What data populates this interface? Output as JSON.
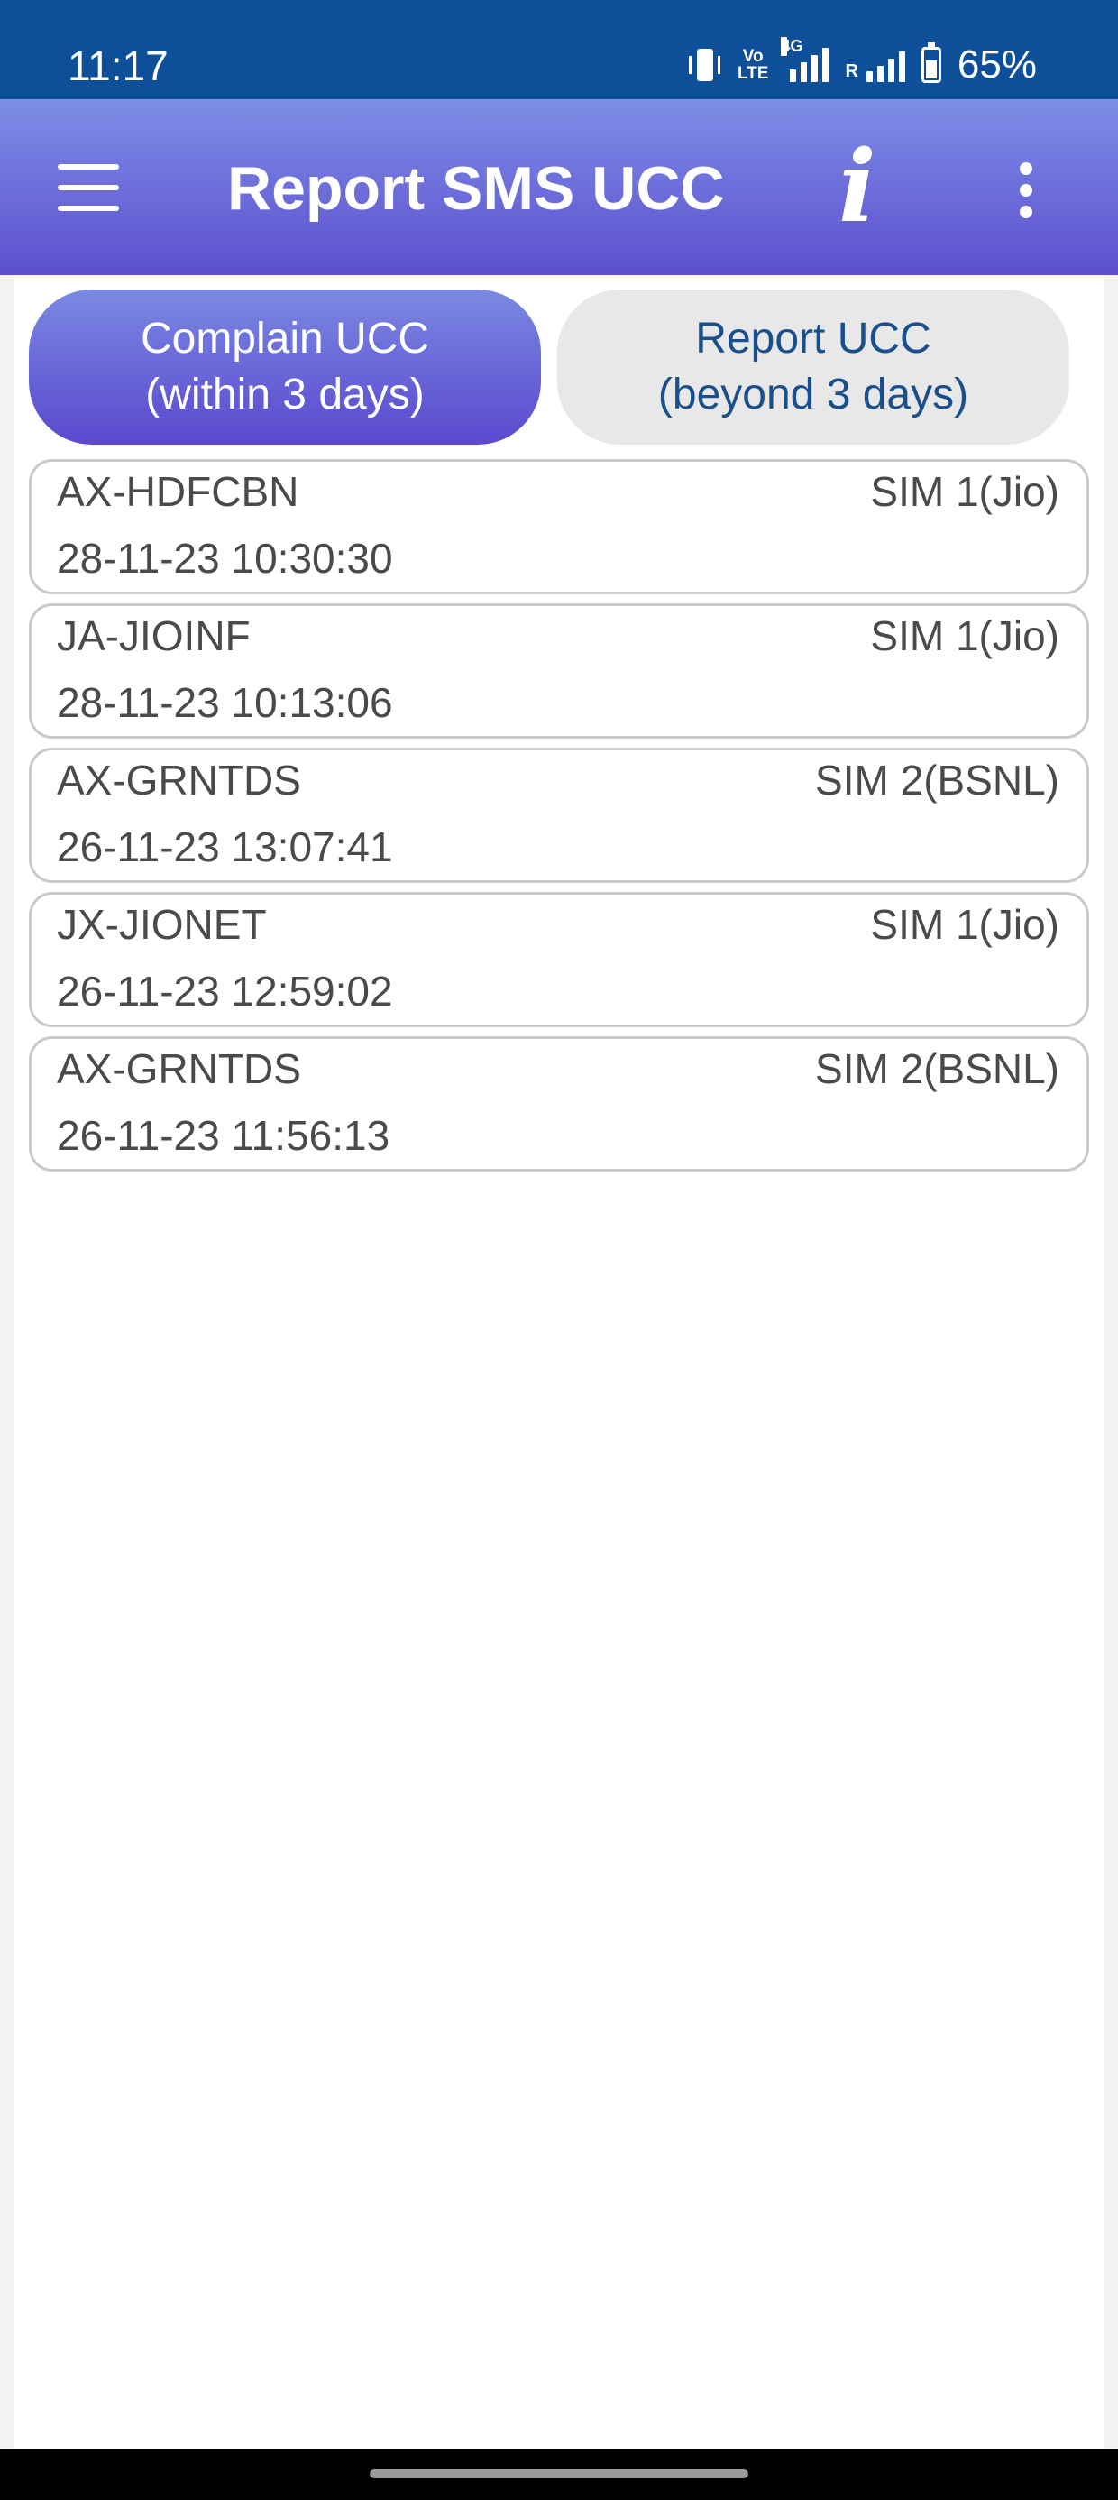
{
  "status_bar": {
    "time": "11:17",
    "network_label": "4G",
    "roaming_label": "R",
    "volte_line1": "Vo",
    "volte_line2": "LTE",
    "battery": "65%",
    "icons": [
      "vibrate-icon",
      "volte-icon",
      "signal-icon",
      "signal-icon",
      "battery-icon"
    ]
  },
  "app_bar": {
    "title": "Report SMS UCC",
    "info_glyph": "i",
    "icons": [
      "menu-icon",
      "info-icon",
      "more-vert-icon"
    ],
    "gradient": [
      "#7d8ee6",
      "#5d4fcf"
    ]
  },
  "tabs": [
    {
      "line1": "Complain UCC",
      "line2": "(within 3 days)",
      "active": true
    },
    {
      "line1": "Report UCC",
      "line2": "(beyond 3 days)",
      "active": false
    }
  ],
  "messages": [
    {
      "sender": "AX-HDFCBN",
      "sim": "SIM 1(Jio)",
      "timestamp": "28-11-23 10:30:30"
    },
    {
      "sender": "JA-JIOINF",
      "sim": "SIM 1(Jio)",
      "timestamp": "28-11-23 10:13:06"
    },
    {
      "sender": "AX-GRNTDS",
      "sim": "SIM 2(BSNL)",
      "timestamp": "26-11-23 13:07:41"
    },
    {
      "sender": "JX-JIONET",
      "sim": "SIM 1(Jio)",
      "timestamp": "26-11-23 12:59:02"
    },
    {
      "sender": "AX-GRNTDS",
      "sim": "SIM 2(BSNL)",
      "timestamp": "26-11-23 11:56:13"
    }
  ],
  "colors": {
    "status_bar": "#0d4f98",
    "accent": "#5d4fcf",
    "inactive_tab_text": "#1a4f8e"
  }
}
